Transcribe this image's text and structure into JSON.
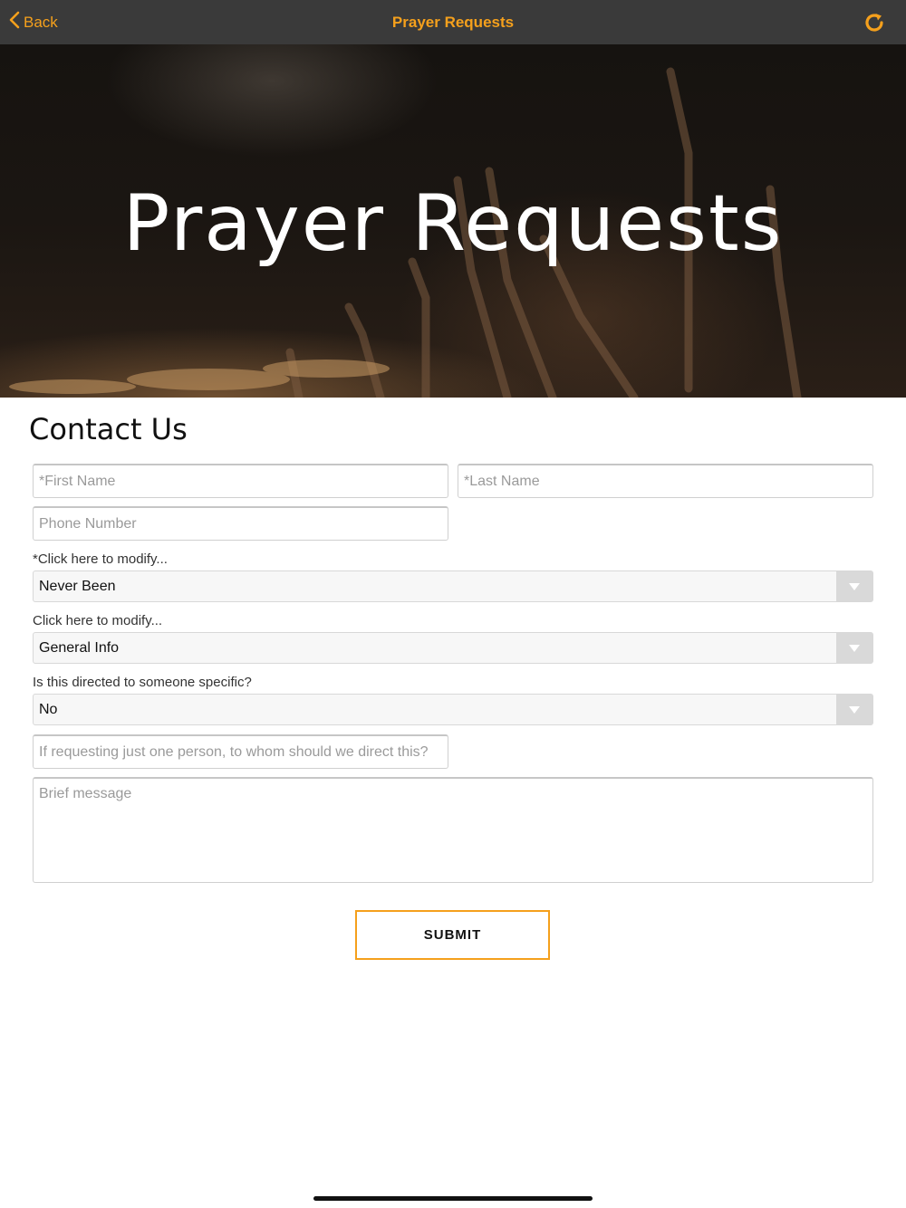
{
  "nav": {
    "back_label": "Back",
    "title": "Prayer Requests",
    "accent_color": "#f5a01c",
    "refresh_icon": "refresh-icon"
  },
  "hero": {
    "title": "Prayer Requests"
  },
  "form": {
    "section_title": "Contact Us",
    "first_name_placeholder": "*First Name",
    "last_name_placeholder": "*Last Name",
    "phone_placeholder": "Phone Number",
    "select1": {
      "label": "*Click here to modify...",
      "value": "Never Been"
    },
    "select2": {
      "label": "Click here to modify...",
      "value": "General Info"
    },
    "select3": {
      "label": "Is this directed to someone specific?",
      "value": "No"
    },
    "direct_to_placeholder": "If requesting just one person, to whom should we direct this?",
    "message_placeholder": "Brief message",
    "submit_label": "SUBMIT"
  }
}
